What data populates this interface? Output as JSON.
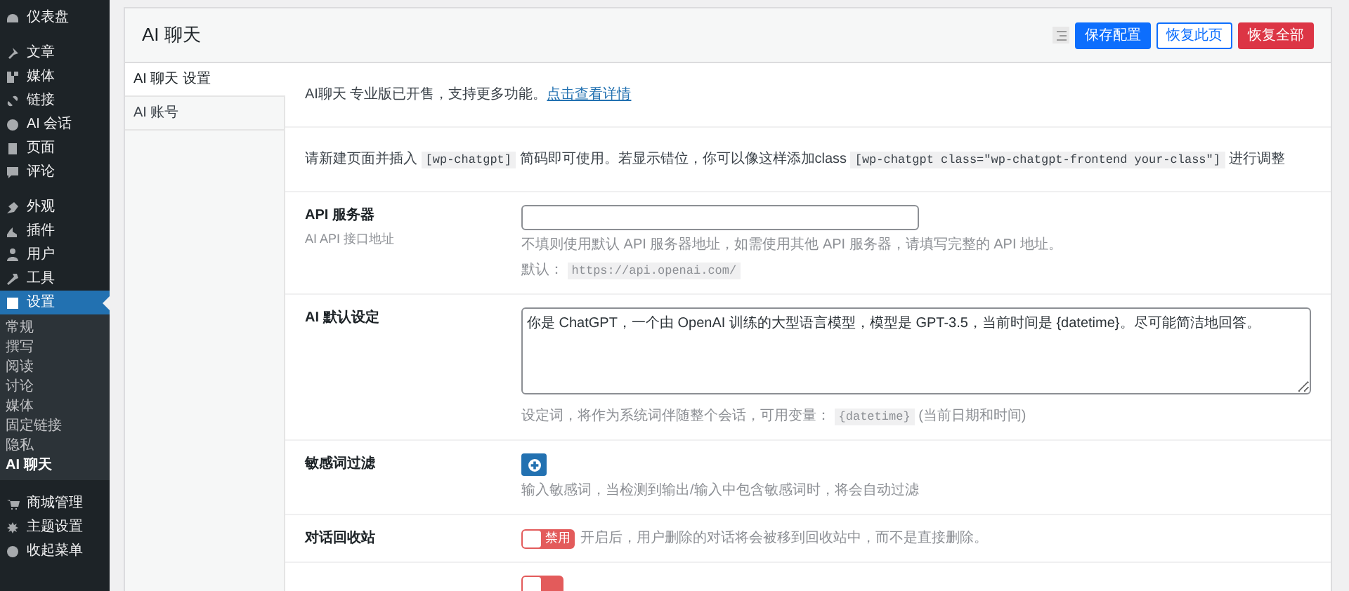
{
  "sidebar": {
    "sections": [
      {
        "items": [
          {
            "label": "仪表盘",
            "selected": false
          }
        ]
      },
      {
        "items": [
          {
            "label": "文章",
            "selected": false
          },
          {
            "label": "媒体",
            "selected": false
          },
          {
            "label": "链接",
            "selected": false
          },
          {
            "label": "AI 会话",
            "selected": false
          },
          {
            "label": "页面",
            "selected": false
          },
          {
            "label": "评论",
            "selected": false
          }
        ]
      },
      {
        "items": [
          {
            "label": "外观",
            "selected": false
          },
          {
            "label": "插件",
            "selected": false
          },
          {
            "label": "用户",
            "selected": false
          },
          {
            "label": "工具",
            "selected": false
          },
          {
            "label": "设置",
            "selected": true,
            "children": [
              {
                "label": "常规",
                "selected": false
              },
              {
                "label": "撰写",
                "selected": false
              },
              {
                "label": "阅读",
                "selected": false
              },
              {
                "label": "讨论",
                "selected": false
              },
              {
                "label": "媒体",
                "selected": false
              },
              {
                "label": "固定链接",
                "selected": false
              },
              {
                "label": "隐私",
                "selected": false
              },
              {
                "label": "AI 聊天",
                "selected": true
              }
            ]
          }
        ]
      },
      {
        "items": [
          {
            "label": "商城管理",
            "selected": false
          },
          {
            "label": "主题设置",
            "selected": false
          },
          {
            "label": "收起菜单",
            "selected": false
          }
        ]
      }
    ]
  },
  "page": {
    "title": "AI 聊天",
    "buttons": [
      {
        "label": "保存配置",
        "kind": "primary"
      },
      {
        "label": "恢复此页",
        "kind": "outline"
      },
      {
        "label": "恢复全部",
        "kind": "danger"
      }
    ]
  },
  "tabs": [
    {
      "label": "AI 聊天 设置",
      "selected": true
    },
    {
      "label": "AI 账号",
      "selected": false
    }
  ],
  "rows": [
    {
      "kind": "notice",
      "text": "AI聊天 专业版已开售，支持更多功能。",
      "link": "点击查看详情"
    },
    {
      "kind": "notice",
      "parts": [
        {
          "kind": "text",
          "text": "请新建页面并插入 "
        },
        {
          "kind": "code",
          "text": "[wp-chatgpt]"
        },
        {
          "kind": "text",
          "text": " 简码即可使用。若显示错位，你可以像这样添加class "
        },
        {
          "kind": "code",
          "text": "[wp-chatgpt class=\"wp-chatgpt-frontend your-class\"]"
        },
        {
          "kind": "text",
          "text": " 进行调整"
        }
      ]
    },
    {
      "kind": "input",
      "label": "API 服务器",
      "sublabel": "AI API 接口地址",
      "value": "",
      "help": [
        [
          {
            "kind": "text",
            "text": "不填则使用默认 API 服务器地址，如需使用其他 API 服务器，请填写完整的 API 地址。"
          }
        ],
        [
          {
            "kind": "text",
            "text": "默认： "
          },
          {
            "kind": "code",
            "text": "https://api.openai.com/"
          }
        ]
      ]
    },
    {
      "kind": "textarea",
      "label": "AI 默认设定",
      "value": "你是 ChatGPT，一个由 OpenAI 训练的大型语言模型，模型是 GPT-3.5，当前时间是 {datetime}。尽可能简洁地回答。",
      "help": [
        [
          {
            "kind": "text",
            "text": "设定词，将作为系统词伴随整个会话，可用变量： "
          },
          {
            "kind": "code",
            "text": "{datetime}"
          },
          {
            "kind": "text",
            "text": " (当前日期和时间)"
          }
        ]
      ]
    },
    {
      "kind": "add",
      "label": "敏感词过滤",
      "help": [
        [
          {
            "kind": "text",
            "text": "输入敏感词，当检测到输出/输入中包含敏感词时，将会自动过滤"
          }
        ]
      ]
    },
    {
      "kind": "toggle",
      "label": "对话回收站",
      "on": false,
      "toggle_label": "禁用",
      "help": [
        [
          {
            "kind": "text",
            "text": "开启后，用户删除的对话将会被移到回收站中，而不是直接删除。"
          }
        ]
      ]
    },
    {
      "kind": "toggle",
      "on": false
    }
  ]
}
